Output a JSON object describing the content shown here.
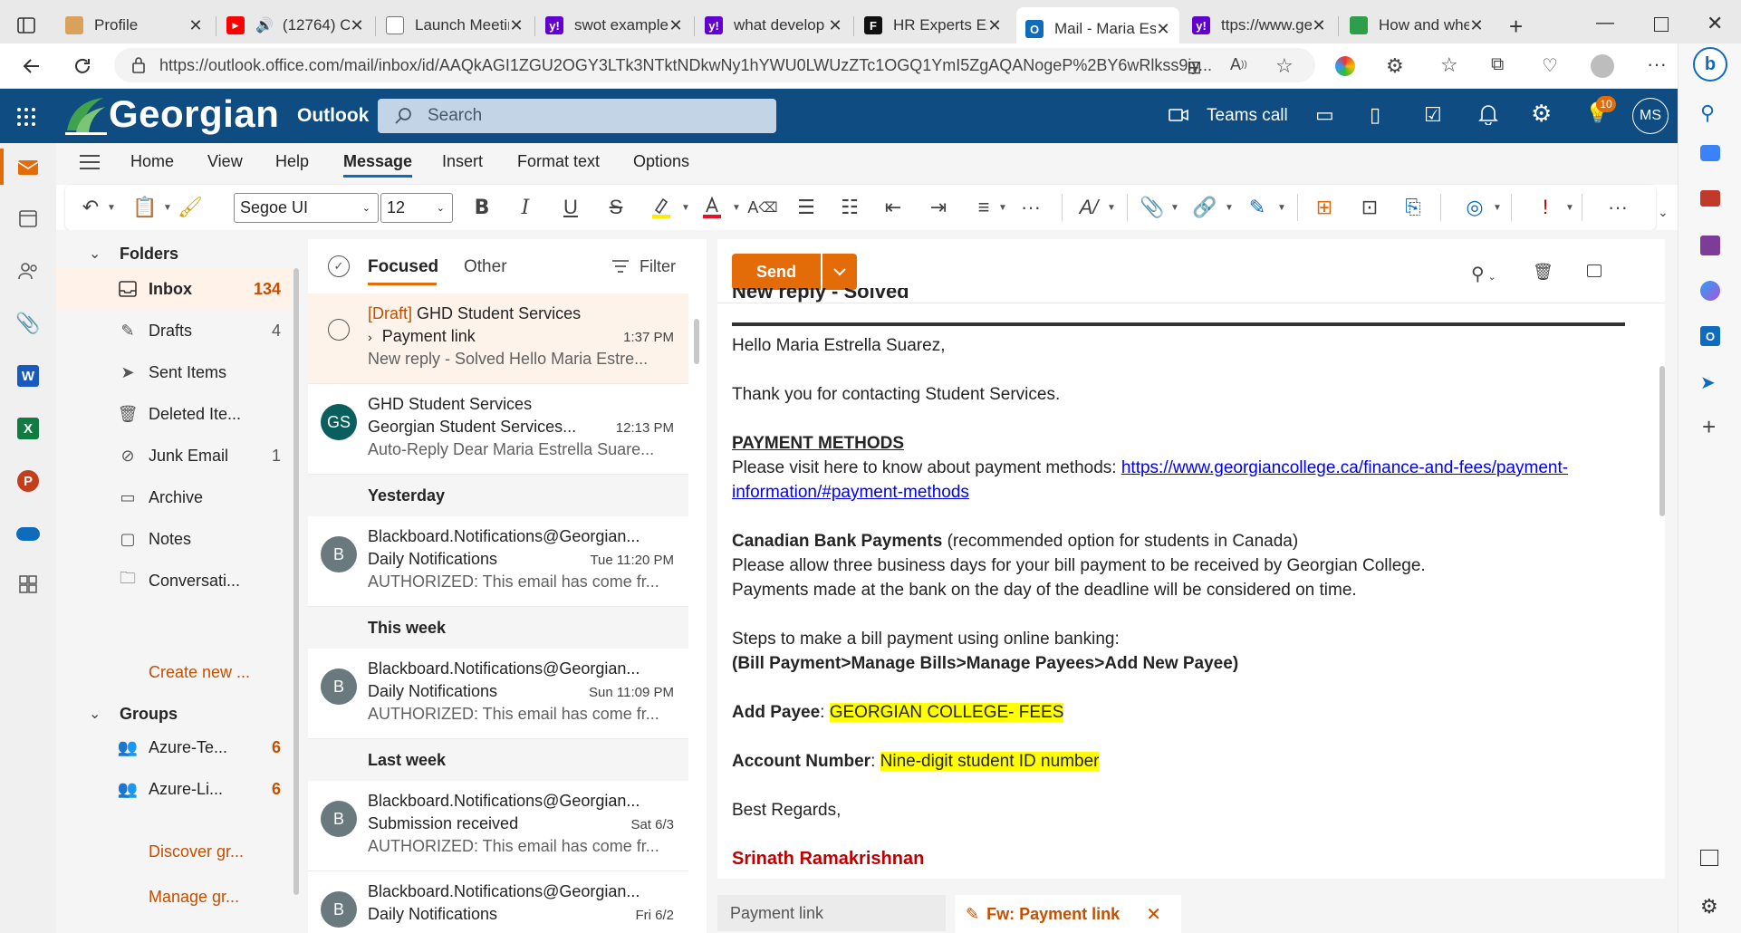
{
  "browser": {
    "tabs": [
      {
        "title": "Profile",
        "favicon": "profile-favicon",
        "color": "#d9a15a"
      },
      {
        "title": "(12764) C",
        "favicon": "youtube-favicon",
        "color": "#ff0000"
      },
      {
        "title": "Launch Meetin",
        "favicon": "page-favicon",
        "color": "#888888"
      },
      {
        "title": "swot example",
        "favicon": "yahoo-favicon",
        "color": "#6001d2"
      },
      {
        "title": "what develop",
        "favicon": "yahoo-favicon",
        "color": "#6001d2"
      },
      {
        "title": "HR Experts Exp",
        "favicon": "forbes-favicon",
        "color": "#111111"
      },
      {
        "title": "Mail - Maria Es",
        "favicon": "outlook-favicon",
        "color": "#0f6cbd"
      },
      {
        "title": "ttps://www.ge",
        "favicon": "yahoo-favicon",
        "color": "#6001d2"
      },
      {
        "title": "How and wher",
        "favicon": "page-favicon",
        "color": "#2e9e4b"
      }
    ],
    "url": "https://outlook.office.com/mail/inbox/id/AAQkAGI1ZGU2OGY3LTk3NTktNDkwNy1hYWU0LWUzZTc1OGQ1YmI5ZgAQANogeP%2BY6wRlkss9iy..."
  },
  "header": {
    "brand": "Georgian",
    "app": "Outlook",
    "search_placeholder": "Search",
    "teams_call": "Teams call",
    "tips_badge": "10",
    "avatar": "MS"
  },
  "ribbon": {
    "tabs": [
      "Home",
      "View",
      "Help",
      "Message",
      "Insert",
      "Format text",
      "Options"
    ],
    "font": "Segoe UI",
    "size": "12"
  },
  "folders": {
    "heading": "Folders",
    "items": [
      {
        "label": "Inbox",
        "count": "134"
      },
      {
        "label": "Drafts",
        "count": "4"
      },
      {
        "label": "Sent Items",
        "count": ""
      },
      {
        "label": "Deleted Ite...",
        "count": ""
      },
      {
        "label": "Junk Email",
        "count": "1"
      },
      {
        "label": "Archive",
        "count": ""
      },
      {
        "label": "Notes",
        "count": ""
      },
      {
        "label": "Conversati...",
        "count": ""
      }
    ],
    "create_new": "Create new ...",
    "groups_heading": "Groups",
    "groups": [
      {
        "label": "Azure-Te...",
        "count": "6"
      },
      {
        "label": "Azure-Li...",
        "count": "6"
      }
    ],
    "discover": "Discover gr...",
    "manage": "Manage gr..."
  },
  "list": {
    "focused": "Focused",
    "other": "Other",
    "filter": "Filter",
    "messages": [
      {
        "draft_tag": "[Draft]",
        "sender": "GHD Student Services",
        "subject": "Payment link",
        "time": "1:37 PM",
        "preview": "New reply - Solved Hello Maria Estre..."
      },
      {
        "initials": "GS",
        "sender": "GHD Student Services",
        "subject": "Georgian Student Services...",
        "time": "12:13 PM",
        "preview": "Auto-Reply Dear Maria Estrella Suare..."
      }
    ],
    "group_yesterday": "Yesterday",
    "group_thisweek": "This week",
    "group_lastweek": "Last week",
    "older": [
      {
        "initials": "B",
        "sender": "Blackboard.Notifications@Georgian...",
        "subject": "Daily Notifications",
        "time": "Tue 11:20 PM",
        "preview": "AUTHORIZED: This email has come fr..."
      },
      {
        "initials": "B",
        "sender": "Blackboard.Notifications@Georgian...",
        "subject": "Daily Notifications",
        "time": "Sun 11:09 PM",
        "preview": "AUTHORIZED: This email has come fr..."
      },
      {
        "initials": "B",
        "sender": "Blackboard.Notifications@Georgian...",
        "subject": "Submission received",
        "time": "Sat 6/3",
        "preview": "AUTHORIZED: This email has come fr..."
      },
      {
        "initials": "B",
        "sender": "Blackboard.Notifications@Georgian...",
        "subject": "Daily Notifications",
        "time": "Fri 6/2",
        "preview": ""
      }
    ]
  },
  "compose": {
    "send": "Send",
    "cut_heading": "New reply - Solved",
    "greeting": "Hello Maria Estrella Suarez,",
    "thanks": "Thank you for contacting Student Services.",
    "pm_heading": "PAYMENT METHODS",
    "pm_text": "Please visit here to know about payment methods: ",
    "pm_link_1": "https://www.georgiancollege.ca/finance-and-fees/payment-",
    "pm_link_2": "information/#payment-methods",
    "cbp_heading": "Canadian Bank Payments",
    "cbp_note": " (recommended option for students in Canada)",
    "cbp_line1": "Please allow three business days for your bill payment to be received by Georgian College.",
    "cbp_line2": "Payments made at the bank on the day of the deadline will be considered on time.",
    "steps_intro": "Steps to make a bill payment using online banking:",
    "steps_path": "(Bill Payment>Manage Bills>Manage Payees>Add New Payee)",
    "add_payee_label": "Add Payee",
    "add_payee_value": "GEORGIAN COLLEGE- FEES",
    "acct_label": "Account Number",
    "acct_value": "Nine-digit student ID number",
    "regards": "Best Regards,",
    "signature": "Srinath Ramakrishnan"
  },
  "bottom_tabs": {
    "tab1": "Payment link",
    "tab2": "Fw: Payment link"
  },
  "colors": {
    "header_bg": "#0f4c81",
    "accent_orange": "#e36c09",
    "signature_red": "#c00000",
    "highlight": "#ffff00"
  }
}
